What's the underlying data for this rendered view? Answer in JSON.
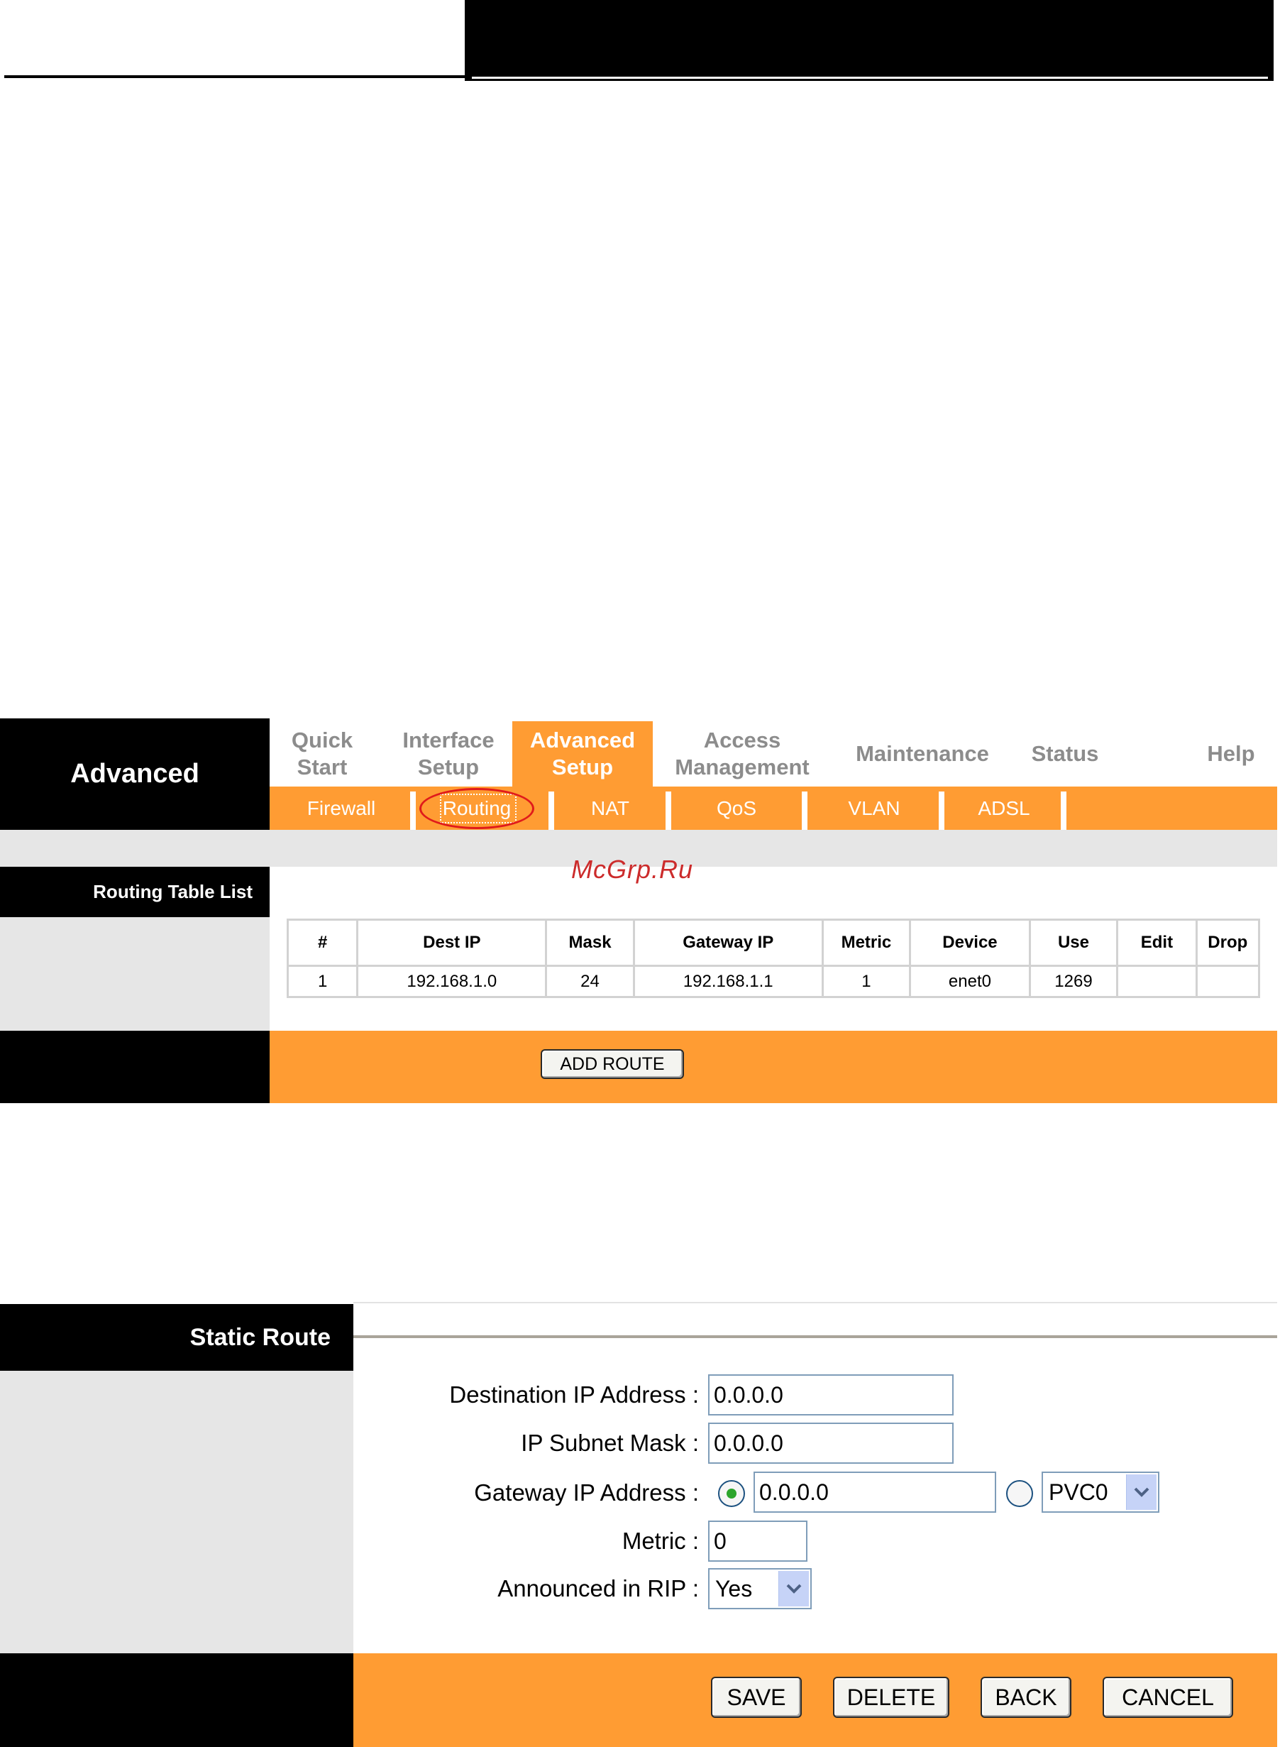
{
  "nav": {
    "section_title": "Advanced",
    "items": [
      {
        "line1": "Quick",
        "line2": "Start"
      },
      {
        "line1": "Interface",
        "line2": "Setup"
      },
      {
        "line1": "Advanced",
        "line2": "Setup"
      },
      {
        "line1": "Access",
        "line2": "Management"
      },
      {
        "line1": "Maintenance",
        "line2": ""
      },
      {
        "line1": "Status",
        "line2": ""
      },
      {
        "line1": "Help",
        "line2": ""
      }
    ],
    "sub_items": [
      "Firewall",
      "Routing",
      "NAT",
      "QoS",
      "VLAN",
      "ADSL"
    ]
  },
  "watermark": "McGrp.Ru",
  "routing_table": {
    "label": "Routing Table List",
    "headers": [
      "#",
      "Dest IP",
      "Mask",
      "Gateway IP",
      "Metric",
      "Device",
      "Use",
      "Edit",
      "Drop"
    ],
    "rows": [
      [
        "1",
        "192.168.1.0",
        "24",
        "192.168.1.1",
        "1",
        "enet0",
        "1269",
        "",
        ""
      ]
    ],
    "add_route_label": "ADD ROUTE"
  },
  "static_route": {
    "label": "Static Route",
    "dest_ip_label": "Destination IP Address :",
    "dest_ip_value": "0.0.0.0",
    "subnet_label": "IP Subnet Mask :",
    "subnet_value": "0.0.0.0",
    "gateway_label": "Gateway IP Address :",
    "gateway_value": "0.0.0.0",
    "gateway_pvc": "PVC0",
    "metric_label": "Metric :",
    "metric_value": "0",
    "rip_label": "Announced in RIP :",
    "rip_value": "Yes",
    "buttons": {
      "save": "SAVE",
      "delete": "DELETE",
      "back": "BACK",
      "cancel": "CANCEL"
    }
  },
  "colors": {
    "accent": "#ff9c33",
    "panel_gray": "#e6e6e6",
    "highlight_circle": "#e01b1b"
  }
}
